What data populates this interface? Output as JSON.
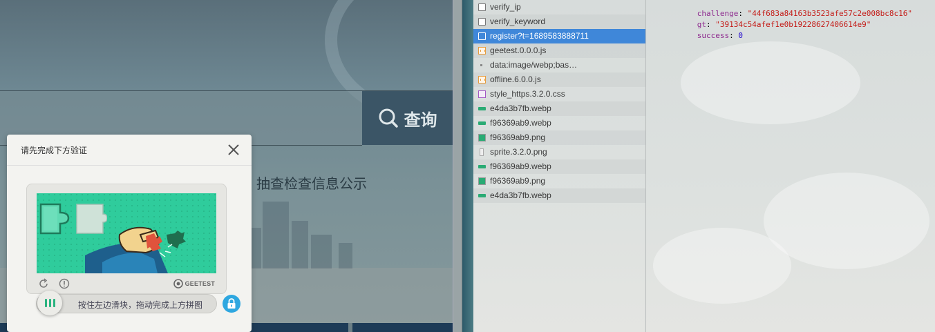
{
  "site": {
    "search_button_label": "查询",
    "notice_link": "抽查检查信息公示"
  },
  "captcha": {
    "title": "请先完成下方验证",
    "brand": "GEETEST",
    "slider_hint": "按住左边滑块，拖动完成上方拼图",
    "icons": {
      "close": "close-icon",
      "refresh": "refresh-icon",
      "feedback": "info-icon",
      "lock": "lock-icon",
      "knob": "slider-grip-icon"
    },
    "accent_color": "#2ec99a",
    "lock_color": "#2ea7e0"
  },
  "network": {
    "requests": [
      {
        "name": "verify_ip",
        "type": "doc"
      },
      {
        "name": "verify_keyword",
        "type": "doc"
      },
      {
        "name": "register?t=1689583888711",
        "type": "doc",
        "selected": true
      },
      {
        "name": "geetest.0.0.0.js",
        "type": "js"
      },
      {
        "name": "data:image/webp;bas…",
        "type": "data"
      },
      {
        "name": "offline.6.0.0.js",
        "type": "js"
      },
      {
        "name": "style_https.3.2.0.css",
        "type": "css"
      },
      {
        "name": "e4da3b7fb.webp",
        "type": "img"
      },
      {
        "name": "f96369ab9.webp",
        "type": "img"
      },
      {
        "name": "f96369ab9.png",
        "type": "png"
      },
      {
        "name": "sprite.3.2.0.png",
        "type": "blank"
      },
      {
        "name": "f96369ab9.webp",
        "type": "img"
      },
      {
        "name": "f96369ab9.png",
        "type": "png"
      },
      {
        "name": "e4da3b7fb.webp",
        "type": "img"
      }
    ],
    "selection_color": "#3f87d9"
  },
  "preview": {
    "lines": [
      {
        "key": "challenge",
        "value": "\"44f683a84163b3523afe57c2e008bc8c16\"",
        "kind": "str"
      },
      {
        "key": "gt",
        "value": "\"39134c54afef1e0b19228627406614e9\"",
        "kind": "str"
      },
      {
        "key": "success",
        "value": "0",
        "kind": "num"
      }
    ]
  }
}
